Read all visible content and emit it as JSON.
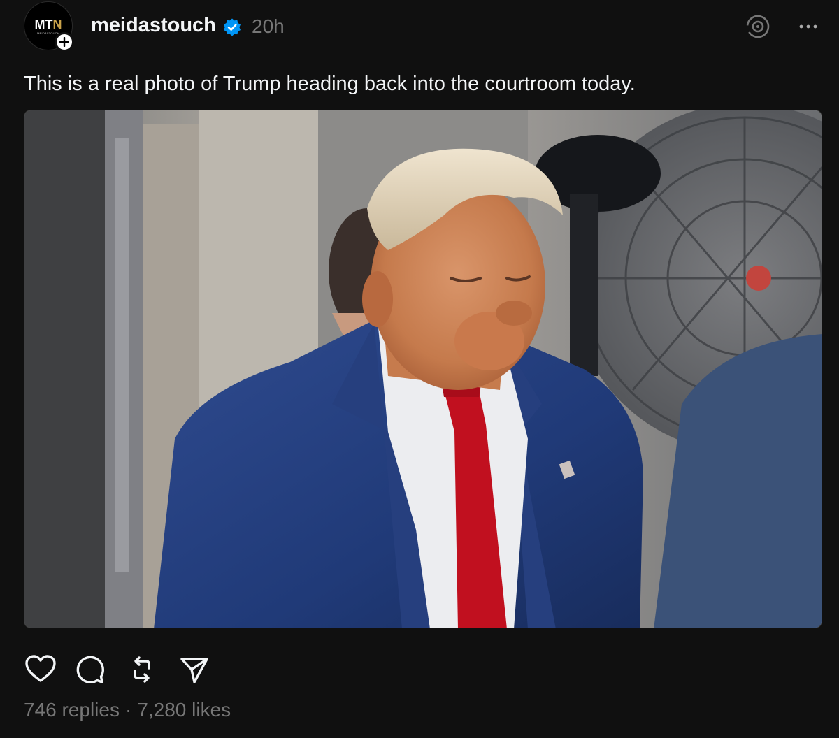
{
  "post": {
    "avatar": {
      "logo_text_main": "MT",
      "logo_text_accent": "N",
      "logo_subtext": "MEIDASTOUCH",
      "accent_color": "#c9a24a"
    },
    "follow_icon": "plus-icon",
    "username": "meidastouch",
    "verified_icon": "verified-badge-icon",
    "verified_color": "#0095f6",
    "timestamp": "20h",
    "caption": "This is a real photo of Trump heading back into the courtroom today.",
    "photo_icon": "post-photo",
    "actions": [
      {
        "name": "like",
        "icon": "heart-icon"
      },
      {
        "name": "reply",
        "icon": "comment-icon"
      },
      {
        "name": "repost",
        "icon": "repost-icon"
      },
      {
        "name": "share",
        "icon": "send-icon"
      }
    ],
    "stats": {
      "replies": "746 replies",
      "separator": "·",
      "likes": "7,280 likes"
    }
  },
  "colors": {
    "background": "#101010",
    "primary_text": "#f3f5f7",
    "secondary_text": "#777777"
  }
}
